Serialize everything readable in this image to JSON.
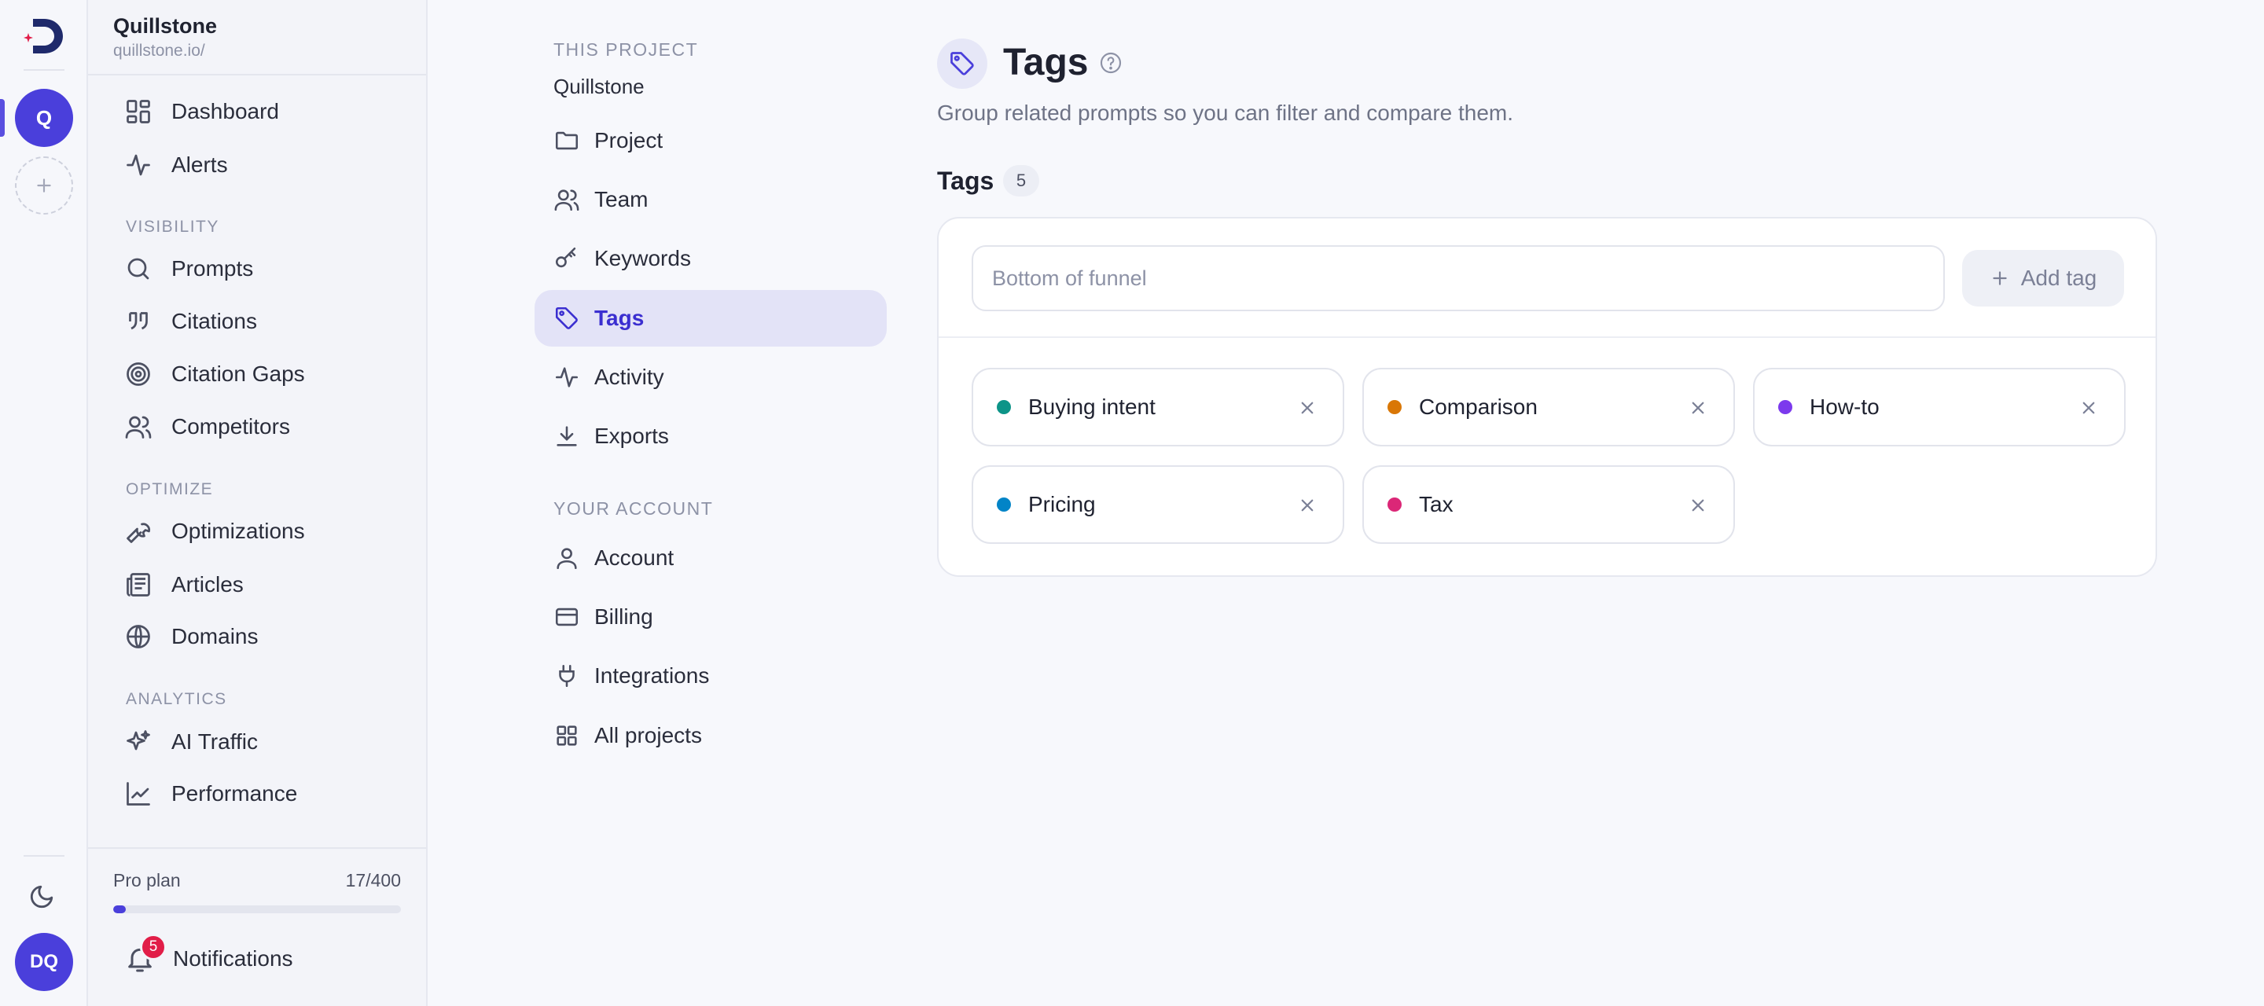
{
  "workspace": {
    "name": "Quillstone",
    "url": "quillstone.io/"
  },
  "rail": {
    "project_initial": "Q",
    "user_initials": "DQ"
  },
  "sidebar": {
    "top": [
      {
        "label": "Dashboard",
        "icon": "dashboard-icon"
      },
      {
        "label": "Alerts",
        "icon": "activity-icon"
      }
    ],
    "sections": [
      {
        "title": "VISIBILITY",
        "items": [
          {
            "label": "Prompts",
            "icon": "search-icon"
          },
          {
            "label": "Citations",
            "icon": "quote-icon"
          },
          {
            "label": "Citation Gaps",
            "icon": "target-icon"
          },
          {
            "label": "Competitors",
            "icon": "users-icon"
          }
        ]
      },
      {
        "title": "OPTIMIZE",
        "items": [
          {
            "label": "Optimizations",
            "icon": "wrench-icon"
          },
          {
            "label": "Articles",
            "icon": "newspaper-icon"
          },
          {
            "label": "Domains",
            "icon": "globe-icon"
          }
        ]
      },
      {
        "title": "ANALYTICS",
        "items": [
          {
            "label": "AI Traffic",
            "icon": "sparkles-icon"
          },
          {
            "label": "Performance",
            "icon": "line-chart-icon"
          }
        ]
      }
    ],
    "plan": {
      "label": "Pro plan",
      "count": "17/400",
      "used": 17,
      "limit": 400
    },
    "notifications": {
      "label": "Notifications",
      "badge": "5"
    }
  },
  "settings_nav": {
    "project_section": "THIS PROJECT",
    "project_name": "Quillstone",
    "project_items": [
      {
        "label": "Project",
        "icon": "folder-icon"
      },
      {
        "label": "Team",
        "icon": "users-icon"
      },
      {
        "label": "Keywords",
        "icon": "key-icon"
      },
      {
        "label": "Tags",
        "icon": "tag-icon",
        "active": true
      },
      {
        "label": "Activity",
        "icon": "activity-icon"
      },
      {
        "label": "Exports",
        "icon": "download-icon"
      }
    ],
    "account_section": "YOUR ACCOUNT",
    "account_items": [
      {
        "label": "Account",
        "icon": "user-icon"
      },
      {
        "label": "Billing",
        "icon": "credit-card-icon"
      },
      {
        "label": "Integrations",
        "icon": "plug-icon"
      },
      {
        "label": "All projects",
        "icon": "grid-icon"
      }
    ]
  },
  "page": {
    "title": "Tags",
    "subtitle": "Group related prompts so you can filter and compare them.",
    "section_title": "Tags",
    "count": "5",
    "input": {
      "value": "",
      "placeholder": "Bottom of funnel"
    },
    "add_button": "Add tag",
    "tags": [
      {
        "label": "Buying intent",
        "color": "#0d9488"
      },
      {
        "label": "Comparison",
        "color": "#d97706"
      },
      {
        "label": "How-to",
        "color": "#7c3aed"
      },
      {
        "label": "Pricing",
        "color": "#0284c7"
      },
      {
        "label": "Tax",
        "color": "#db2777"
      }
    ]
  },
  "colors": {
    "accent": "#4a3fdb",
    "active_bg": "#e3e3f7",
    "badge": "#e11d48"
  }
}
